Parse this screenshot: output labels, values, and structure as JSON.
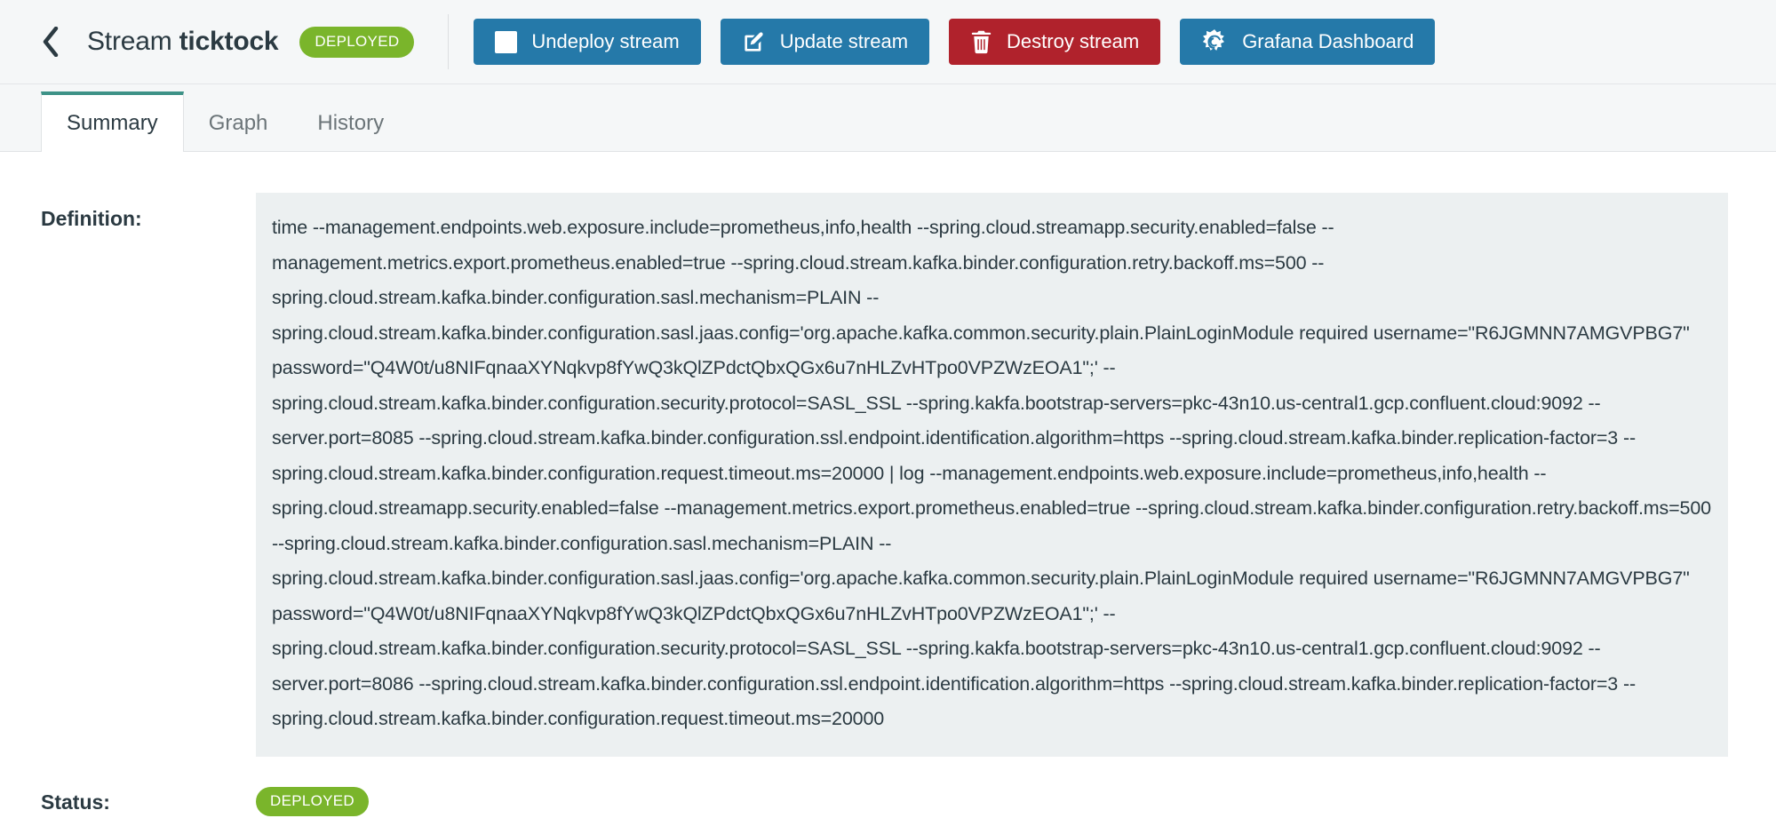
{
  "header": {
    "back_icon": "chevron-left-icon",
    "title_prefix": "Stream ",
    "title_name": "ticktock",
    "status_badge": "DEPLOYED",
    "buttons": [
      {
        "label": "Undeploy stream",
        "icon": "stop-square-icon",
        "style": "blue"
      },
      {
        "label": "Update stream",
        "icon": "edit-pencil-icon",
        "style": "blue"
      },
      {
        "label": "Destroy stream",
        "icon": "trash-icon",
        "style": "red"
      },
      {
        "label": "Grafana Dashboard",
        "icon": "grafana-icon",
        "style": "blue"
      }
    ]
  },
  "tabs": [
    {
      "label": "Summary",
      "active": true
    },
    {
      "label": "Graph",
      "active": false
    },
    {
      "label": "History",
      "active": false
    }
  ],
  "summary": {
    "definition_label": "Definition:",
    "definition_value": "time --management.endpoints.web.exposure.include=prometheus,info,health --spring.cloud.streamapp.security.enabled=false --management.metrics.export.prometheus.enabled=true --spring.cloud.stream.kafka.binder.configuration.retry.backoff.ms=500 --spring.cloud.stream.kafka.binder.configuration.sasl.mechanism=PLAIN --spring.cloud.stream.kafka.binder.configuration.sasl.jaas.config='org.apache.kafka.common.security.plain.PlainLoginModule required username=\"R6JGMNN7AMGVPBG7\" password=\"Q4W0t/u8NIFqnaaXYNqkvp8fYwQ3kQlZPdctQbxQGx6u7nHLZvHTpo0VPZWzEOA1\";' --spring.cloud.stream.kafka.binder.configuration.security.protocol=SASL_SSL --spring.kakfa.bootstrap-servers=pkc-43n10.us-central1.gcp.confluent.cloud:9092 --server.port=8085 --spring.cloud.stream.kafka.binder.configuration.ssl.endpoint.identification.algorithm=https --spring.cloud.stream.kafka.binder.replication-factor=3 --spring.cloud.stream.kafka.binder.configuration.request.timeout.ms=20000 | log --management.endpoints.web.exposure.include=prometheus,info,health --spring.cloud.streamapp.security.enabled=false --management.metrics.export.prometheus.enabled=true --spring.cloud.stream.kafka.binder.configuration.retry.backoff.ms=500 --spring.cloud.stream.kafka.binder.configuration.sasl.mechanism=PLAIN --spring.cloud.stream.kafka.binder.configuration.sasl.jaas.config='org.apache.kafka.common.security.plain.PlainLoginModule required username=\"R6JGMNN7AMGVPBG7\" password=\"Q4W0t/u8NIFqnaaXYNqkvp8fYwQ3kQlZPdctQbxQGx6u7nHLZvHTpo0VPZWzEOA1\";' --spring.cloud.stream.kafka.binder.configuration.security.protocol=SASL_SSL --spring.kakfa.bootstrap-servers=pkc-43n10.us-central1.gcp.confluent.cloud:9092 --server.port=8086 --spring.cloud.stream.kafka.binder.configuration.ssl.endpoint.identification.algorithm=https --spring.cloud.stream.kafka.binder.replication-factor=3 --spring.cloud.stream.kafka.binder.configuration.request.timeout.ms=20000",
    "status_label": "Status:",
    "status_value": "DEPLOYED"
  },
  "colors": {
    "primary_blue": "#2579a9",
    "danger_red": "#b0222c",
    "status_green": "#7ab52b",
    "tab_accent": "#3d9287",
    "code_bg": "#ecf0f1",
    "header_bg": "#f5f7f8"
  }
}
